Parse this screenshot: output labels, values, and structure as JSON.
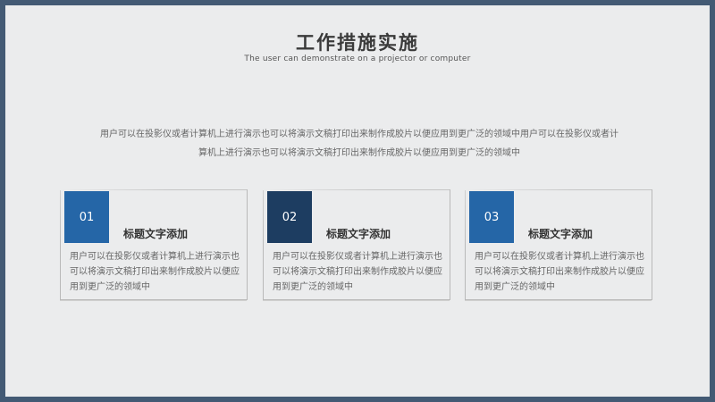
{
  "slide": {
    "title": "工作措施实施",
    "subtitle": "The user can demonstrate on a projector or computer",
    "intro": "用户可以在投影仪或者计算机上进行演示也可以将演示文稿打印出来制作成胶片以便应用到更广泛的领域中用户可以在投影仪或者计算机上进行演示也可以将演示文稿打印出来制作成胶片以便应用到更广泛的领域中"
  },
  "colors": {
    "border": "#435a74",
    "background": "#ebeced",
    "card_accents": [
      "#2566a7",
      "#1d3d61",
      "#2566a7"
    ]
  },
  "cards": [
    {
      "number": "01",
      "title": "标题文字添加",
      "text": "用户可以在投影仪或者计算机上进行演示也可以将演示文稿打印出来制作成胶片以便应用到更广泛的领域中"
    },
    {
      "number": "02",
      "title": "标题文字添加",
      "text": "用户可以在投影仪或者计算机上进行演示也可以将演示文稿打印出来制作成胶片以便应用到更广泛的领域中"
    },
    {
      "number": "03",
      "title": "标题文字添加",
      "text": "用户可以在投影仪或者计算机上进行演示也可以将演示文稿打印出来制作成胶片以便应用到更广泛的领域中"
    }
  ]
}
